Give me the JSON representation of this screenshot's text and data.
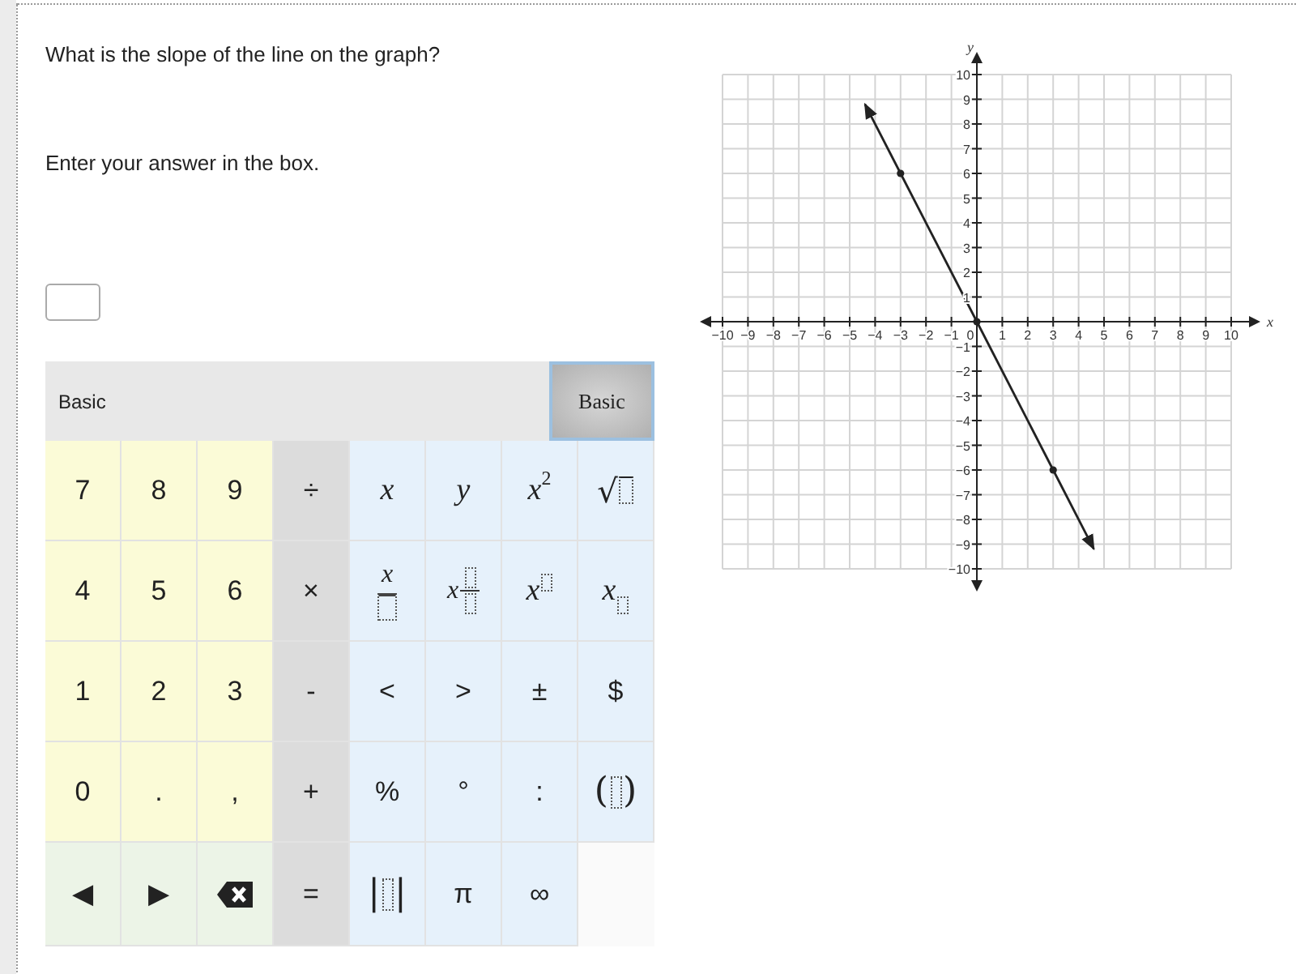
{
  "question": "What is the slope of the line on the graph?",
  "instruction": "Enter your answer in the box.",
  "keypad": {
    "title": "Basic",
    "tabs": [
      {
        "label": "Basic",
        "selected": true
      }
    ],
    "rows": [
      [
        {
          "kind": "text",
          "color": "#fbfbd7",
          "label": "7"
        },
        {
          "kind": "text",
          "color": "#fbfbd7",
          "label": "8"
        },
        {
          "kind": "text",
          "color": "#fbfbd7",
          "label": "9"
        },
        {
          "kind": "text",
          "color": "#dcdcdc",
          "label": "÷"
        },
        {
          "kind": "variable",
          "color": "#e6f1fb",
          "label": "x"
        },
        {
          "kind": "variable",
          "color": "#e6f1fb",
          "label": "y"
        },
        {
          "kind": "power",
          "color": "#e6f1fb",
          "label": "x",
          "exponent": "2"
        },
        {
          "kind": "sqrt-slot",
          "color": "#e6f1fb",
          "label": "√"
        }
      ],
      [
        {
          "kind": "text",
          "color": "#fbfbd7",
          "label": "4"
        },
        {
          "kind": "text",
          "color": "#fbfbd7",
          "label": "5"
        },
        {
          "kind": "text",
          "color": "#fbfbd7",
          "label": "6"
        },
        {
          "kind": "text",
          "color": "#dcdcdc",
          "label": "×"
        },
        {
          "kind": "fraction-slot",
          "color": "#e6f1fb",
          "label": "x"
        },
        {
          "kind": "mixed-slot",
          "color": "#e6f1fb",
          "label": "x"
        },
        {
          "kind": "power-slot",
          "color": "#e6f1fb",
          "label": "x"
        },
        {
          "kind": "sub-slot",
          "color": "#e6f1fb",
          "label": "x"
        }
      ],
      [
        {
          "kind": "text",
          "color": "#fbfbd7",
          "label": "1"
        },
        {
          "kind": "text",
          "color": "#fbfbd7",
          "label": "2"
        },
        {
          "kind": "text",
          "color": "#fbfbd7",
          "label": "3"
        },
        {
          "kind": "text",
          "color": "#dcdcdc",
          "label": "-"
        },
        {
          "kind": "text",
          "color": "#e6f1fb",
          "label": "<"
        },
        {
          "kind": "text",
          "color": "#e6f1fb",
          "label": ">"
        },
        {
          "kind": "text",
          "color": "#e6f1fb",
          "label": "±"
        },
        {
          "kind": "text",
          "color": "#e6f1fb",
          "label": "$"
        }
      ],
      [
        {
          "kind": "text",
          "color": "#fbfbd7",
          "label": "0"
        },
        {
          "kind": "text",
          "color": "#fbfbd7",
          "label": "."
        },
        {
          "kind": "text",
          "color": "#fbfbd7",
          "label": ","
        },
        {
          "kind": "text",
          "color": "#dcdcdc",
          "label": "+"
        },
        {
          "kind": "text",
          "color": "#e6f1fb",
          "label": "%"
        },
        {
          "kind": "text",
          "color": "#e6f1fb",
          "label": "°"
        },
        {
          "kind": "text",
          "color": "#e6f1fb",
          "label": ":"
        },
        {
          "kind": "wrap-slot",
          "color": "#e6f1fb",
          "open": "(",
          "close": ")"
        }
      ],
      [
        {
          "kind": "text",
          "color": "#ecf4e7",
          "label": "◀"
        },
        {
          "kind": "text",
          "color": "#ecf4e7",
          "label": "▶"
        },
        {
          "kind": "backspace",
          "color": "#ecf4e7"
        },
        {
          "kind": "text",
          "color": "#dcdcdc",
          "label": "="
        },
        {
          "kind": "wrap-slot",
          "color": "#e6f1fb",
          "open": "|",
          "close": "|"
        },
        {
          "kind": "text",
          "color": "#e6f1fb",
          "label": "π"
        },
        {
          "kind": "text",
          "color": "#e6f1fb",
          "label": "∞"
        }
      ]
    ]
  },
  "graph": {
    "chart_data": {
      "type": "line",
      "xlabel": "x",
      "ylabel": "y",
      "grid": true,
      "x": [
        -4.4,
        -3,
        0,
        3,
        4.6
      ],
      "series": [
        {
          "color": "#222222",
          "marker": "circle",
          "values": [
            8.8,
            6,
            0,
            -6,
            -9.2
          ]
        }
      ],
      "xlim": [
        -10,
        10
      ],
      "ylim": [
        -10,
        10
      ],
      "xticks": [
        {
          "value": -10,
          "label": "−10"
        },
        {
          "value": -9,
          "label": "−9"
        },
        {
          "value": -8,
          "label": "−8"
        },
        {
          "value": -7,
          "label": "−7"
        },
        {
          "value": -6,
          "label": "−6"
        },
        {
          "value": -5,
          "label": "−5"
        },
        {
          "value": -4,
          "label": "−4"
        },
        {
          "value": -3,
          "label": "−3"
        },
        {
          "value": -2,
          "label": "−2"
        },
        {
          "value": -1,
          "label": "−1"
        },
        0,
        1,
        2,
        3,
        4,
        5,
        6,
        7,
        8,
        9,
        10
      ],
      "yticks": [
        {
          "value": -10,
          "label": "−10"
        },
        {
          "value": -9,
          "label": "−9"
        },
        {
          "value": -8,
          "label": "−8"
        },
        {
          "value": -7,
          "label": "−7"
        },
        {
          "value": -6,
          "label": "−6"
        },
        {
          "value": -5,
          "label": "−5"
        },
        {
          "value": -4,
          "label": "−4"
        },
        {
          "value": -3,
          "label": "−3"
        },
        {
          "value": -2,
          "label": "−2"
        },
        {
          "value": -1,
          "label": "−1"
        },
        1,
        2,
        3,
        4,
        5,
        6,
        7,
        8,
        9,
        10
      ]
    }
  }
}
